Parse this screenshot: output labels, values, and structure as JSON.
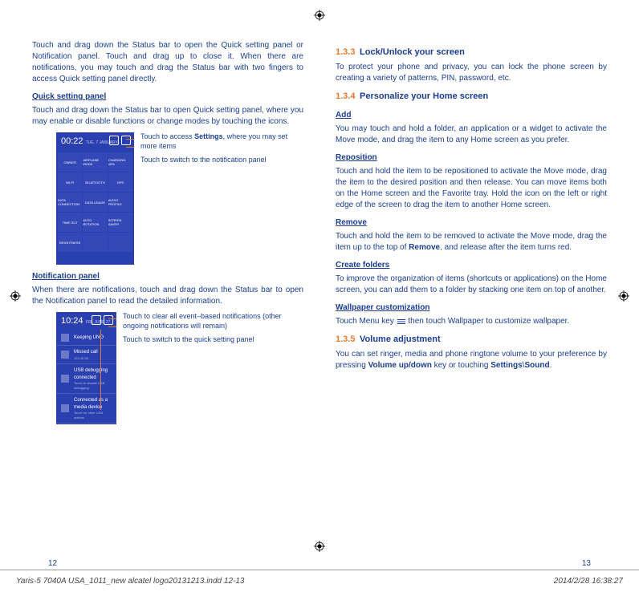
{
  "left": {
    "intro_p1": "Touch and drag down the Status bar to open the Quick setting panel or Notification panel. Touch and drag up to close it. When there are notifications, you may touch and drag the Status bar with two fingers to access Quick setting panel directly.",
    "qsp_heading": "Quick setting panel",
    "qsp_body": "Touch and drag down the Status bar to open Quick setting panel, where you may enable or disable functions or change modes by touching the icons.",
    "qsp_time": "00:22",
    "qsp_time_sub": "TUE, 7 JANUARY",
    "qsp_tiles": [
      "OWNER",
      "AIRPLANE MODE",
      "CHARGING: 49%",
      "WI-FI",
      "BLUETOOTH",
      "GPS",
      "DATA CONNECTION",
      "DATA USAGE",
      "AUDIO PROFILE",
      "TIME OUT",
      "AUTO ROTATION",
      "SCREEN SAVER",
      "BRIGHTNESS",
      "",
      ""
    ],
    "qsp_annot1a": "Touch to access ",
    "qsp_annot1b": "Settings",
    "qsp_annot1c": ", where you may set more items",
    "qsp_annot2": "Touch to switch to the notification panel",
    "np_heading": "Notification panel",
    "np_body": "When there are notifications, touch and drag down the Status bar to open the Notification panel to read the detailed information.",
    "np_time": "10:24",
    "np_time_sub": "FRI, JUNE 27",
    "np_rows": [
      {
        "title": "Keeping UNO",
        "sub": ""
      },
      {
        "title": "Missed call",
        "sub": "123 45 56"
      },
      {
        "title": "USB debugging connected",
        "sub": "Touch to disable USB debugging"
      },
      {
        "title": "Connected as a media device",
        "sub": "Touch for other USB options"
      }
    ],
    "np_annot1": "Touch to clear all event–based notifications (other ongoing notifications will remain)",
    "np_annot2": "Touch to switch to the quick setting panel",
    "page_num": "12"
  },
  "right": {
    "s133_num": "1.3.3",
    "s133_title": "Lock/Unlock your screen",
    "s133_body": "To protect your phone and privacy, you can lock the phone screen by creating a variety of patterns, PIN, password, etc.",
    "s134_num": "1.3.4",
    "s134_title": "Personalize your Home screen",
    "add_h": "Add",
    "add_b": "You may touch and hold a folder, an application or a widget to activate the Move mode, and drag the item to any Home screen as you prefer.",
    "rep_h": "Reposition",
    "rep_b": "Touch and hold the item to be repositioned to activate the Move mode, drag the item to the desired position and then release. You can move items both on the Home screen and the Favorite tray. Hold the icon on the left or right edge of the screen to drag the item to another Home screen.",
    "rem_h": "Remove",
    "rem_b1": "Touch and hold the item to be removed to activate the Move mode, drag the item up to the top of ",
    "rem_b2": "Remove",
    "rem_b3": ", and release after the item turns red.",
    "cf_h": "Create folders",
    "cf_b": "To improve the organization of items (shortcuts or applications) on the Home screen, you can add them to a folder by stacking one item on top of another.",
    "wc_h": "Wallpaper customization",
    "wc_b1": "Touch Menu key ",
    "wc_b2": " then touch Wallpaper to customize wallpaper.",
    "s135_num": "1.3.5",
    "s135_title": "Volume adjustment",
    "s135_b1": "You can set ringer, media and phone ringtone volume to your preference by pressing ",
    "s135_b2": "Volume up/down",
    "s135_b3": " key or touching ",
    "s135_b4": "Settings",
    "s135_b5": "\\",
    "s135_b6": "Sound",
    "s135_b7": ".",
    "page_num": "13"
  },
  "indd": {
    "file": "Yaris-5 7040A USA_1011_new alcatel logo20131213.indd   12-13",
    "stamp": "2014/2/28   16:38:27"
  }
}
